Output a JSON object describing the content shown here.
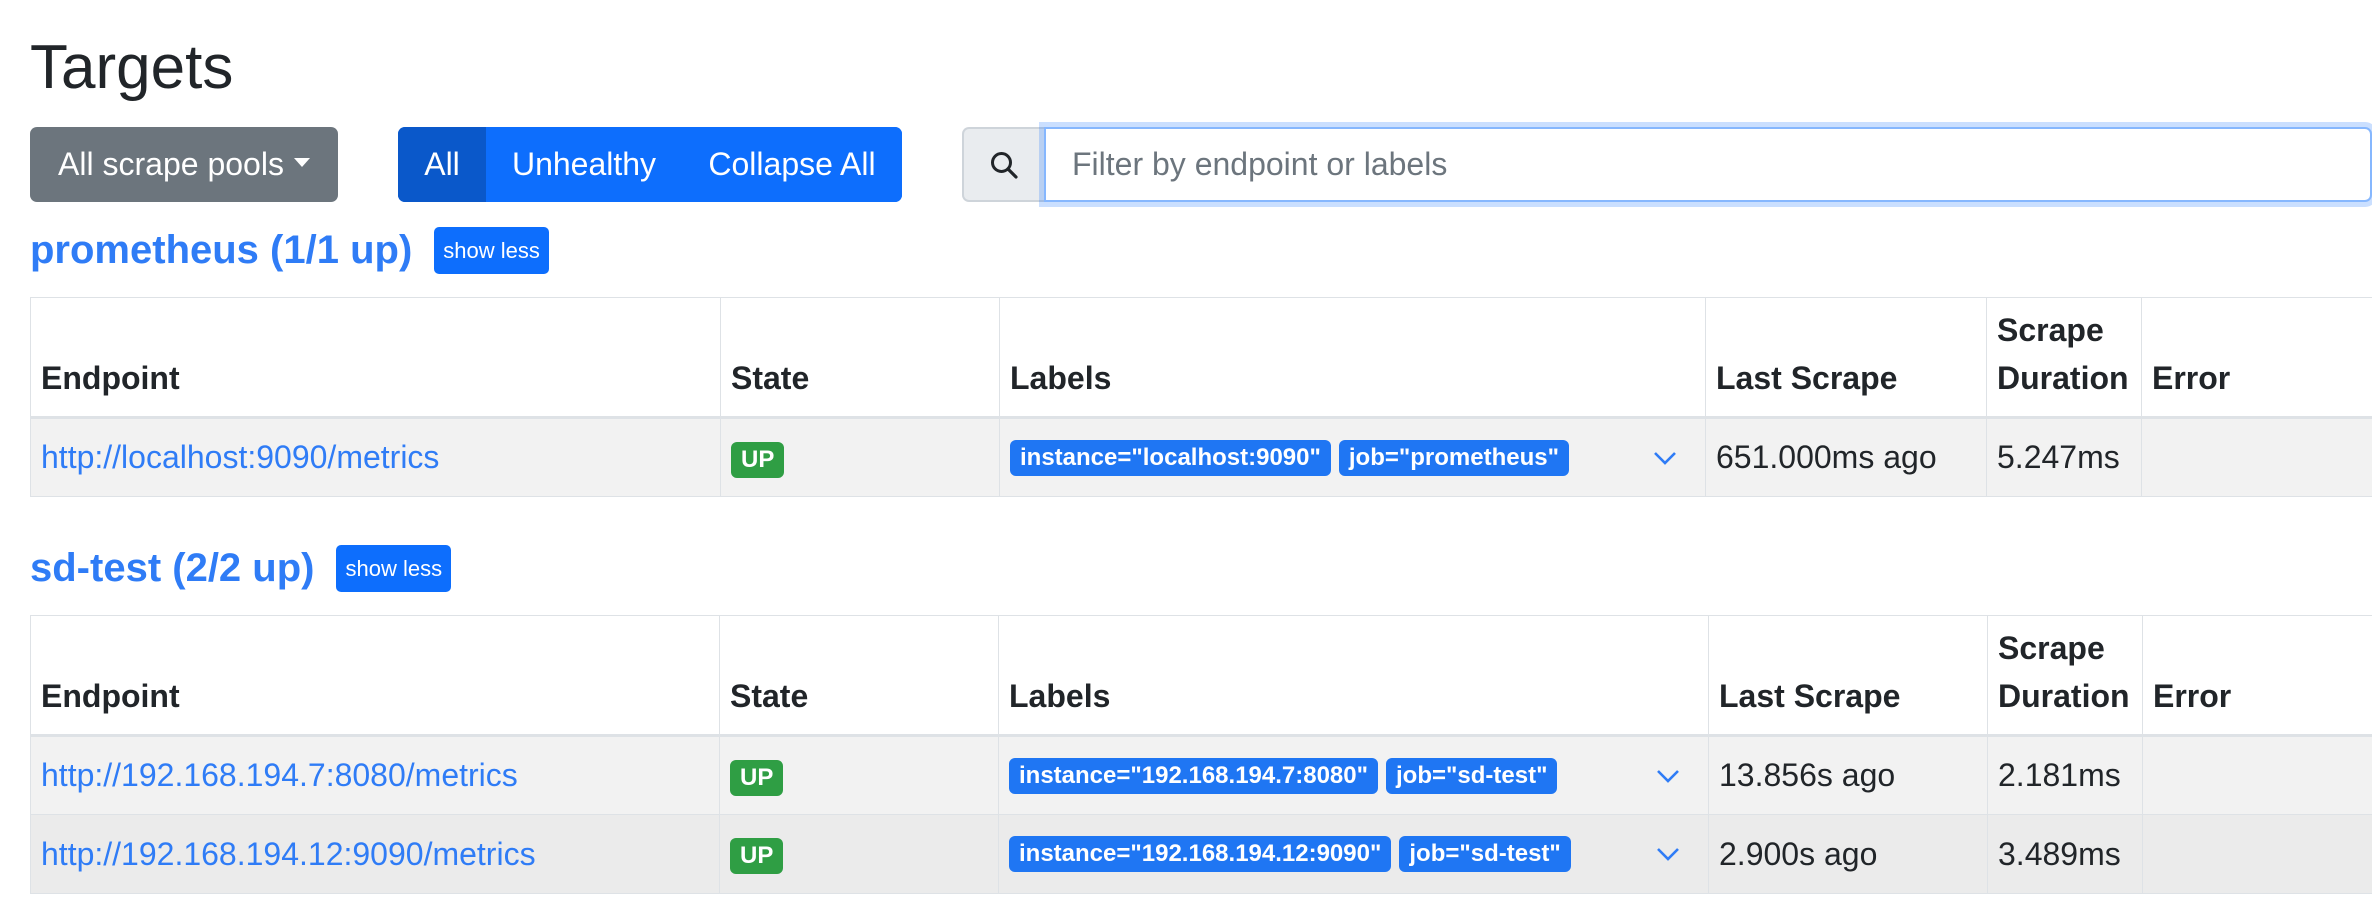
{
  "page": {
    "title": "Targets"
  },
  "toolbar": {
    "pools_dropdown_label": "All scrape pools",
    "filter_all": "All",
    "filter_unhealthy": "Unhealthy",
    "collapse_all": "Collapse All",
    "search_placeholder": "Filter by endpoint or labels",
    "search_value": ""
  },
  "table_headers": {
    "endpoint": "Endpoint",
    "state": "State",
    "labels": "Labels",
    "last_scrape": "Last Scrape",
    "scrape_duration": "Scrape Duration",
    "error": "Error"
  },
  "pools": [
    {
      "title": "prometheus (1/1 up)",
      "toggle_label": "show less",
      "rows": [
        {
          "endpoint": "http://localhost:9090/metrics",
          "state": "UP",
          "labels": [
            "instance=\"localhost:9090\"",
            "job=\"prometheus\""
          ],
          "last_scrape": "651.000ms ago",
          "scrape_duration": "5.247ms",
          "error": ""
        }
      ]
    },
    {
      "title": "sd-test (2/2 up)",
      "toggle_label": "show less",
      "rows": [
        {
          "endpoint": "http://192.168.194.7:8080/metrics",
          "state": "UP",
          "labels": [
            "instance=\"192.168.194.7:8080\"",
            "job=\"sd-test\""
          ],
          "last_scrape": "13.856s ago",
          "scrape_duration": "2.181ms",
          "error": ""
        },
        {
          "endpoint": "http://192.168.194.12:9090/metrics",
          "state": "UP",
          "labels": [
            "instance=\"192.168.194.12:9090\"",
            "job=\"sd-test\""
          ],
          "last_scrape": "2.900s ago",
          "scrape_duration": "3.489ms",
          "error": ""
        }
      ]
    }
  ],
  "colors": {
    "link": "#2f7cf6",
    "primary": "#0d6efd",
    "active": "#0a58ca",
    "secondary": "#6c757d",
    "success": "#2f9e44"
  },
  "icons": {
    "search": "search-icon",
    "expand": "chevron-down-icon",
    "dropdown": "caret-down-icon"
  }
}
